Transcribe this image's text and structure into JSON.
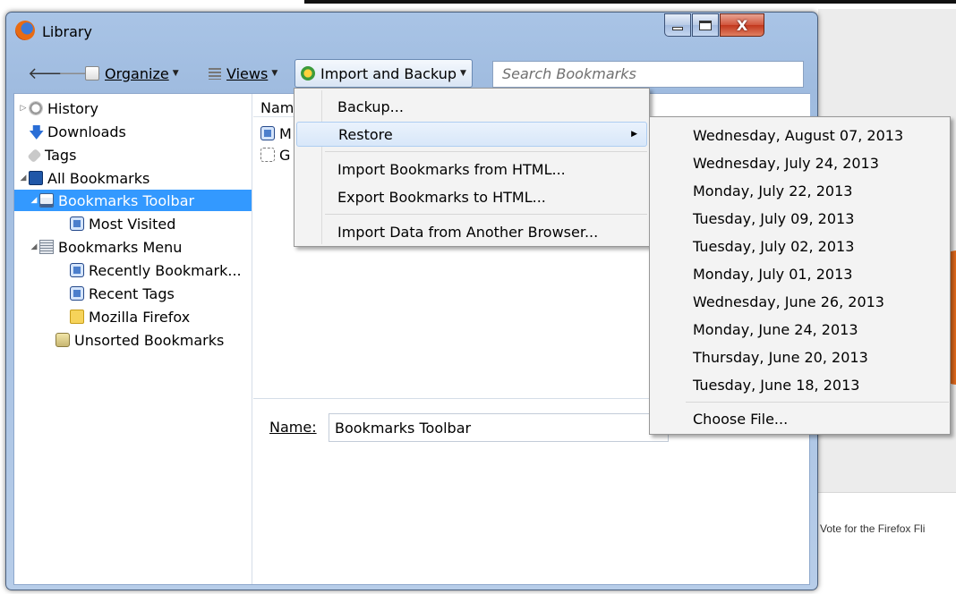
{
  "background": {
    "vote_text": "Vote for the Firefox Fli"
  },
  "window": {
    "title": "Library",
    "controls": {
      "minimize": "minimize-icon",
      "maximize": "maximize-icon",
      "close": "close-icon"
    },
    "close_glyph": "X"
  },
  "toolbar": {
    "back_glyph": "🡐",
    "forward_glyph": "🡒",
    "organize_label": "Organize",
    "views_label": "Views",
    "import_backup_label": "Import and Backup",
    "search_placeholder": "Search Bookmarks"
  },
  "tree": {
    "items": [
      {
        "label": "History",
        "icon": "history-icon"
      },
      {
        "label": "Downloads",
        "icon": "downloads-icon"
      },
      {
        "label": "Tags",
        "icon": "tags-icon"
      },
      {
        "label": "All Bookmarks",
        "icon": "all-bookmarks-icon"
      },
      {
        "label": "Bookmarks Toolbar",
        "icon": "bookmarks-toolbar-icon",
        "selected": true
      },
      {
        "label": "Most Visited",
        "icon": "smart-folder-icon"
      },
      {
        "label": "Bookmarks Menu",
        "icon": "bookmarks-menu-icon"
      },
      {
        "label": "Recently Bookmark...",
        "icon": "smart-folder-icon"
      },
      {
        "label": "Recent Tags",
        "icon": "smart-folder-icon"
      },
      {
        "label": "Mozilla Firefox",
        "icon": "folder-icon"
      },
      {
        "label": "Unsorted Bookmarks",
        "icon": "unsorted-bookmarks-icon"
      }
    ]
  },
  "list": {
    "header_name": "Nam",
    "rows": [
      {
        "text": "M"
      },
      {
        "text": "G"
      }
    ]
  },
  "details": {
    "name_label": "Name:",
    "name_value": "Bookmarks Toolbar"
  },
  "import_menu": {
    "items": [
      "Backup...",
      "Restore",
      "Import Bookmarks from HTML...",
      "Export Bookmarks to HTML...",
      "Import Data from Another Browser..."
    ]
  },
  "restore_menu": {
    "dates": [
      "Wednesday, August 07, 2013",
      "Wednesday, July 24, 2013",
      "Monday, July 22, 2013",
      "Tuesday, July 09, 2013",
      "Tuesday, July 02, 2013",
      "Monday, July 01, 2013",
      "Wednesday, June 26, 2013",
      "Monday, June 24, 2013",
      "Thursday, June 20, 2013",
      "Tuesday, June 18, 2013"
    ],
    "choose_file": "Choose File..."
  }
}
